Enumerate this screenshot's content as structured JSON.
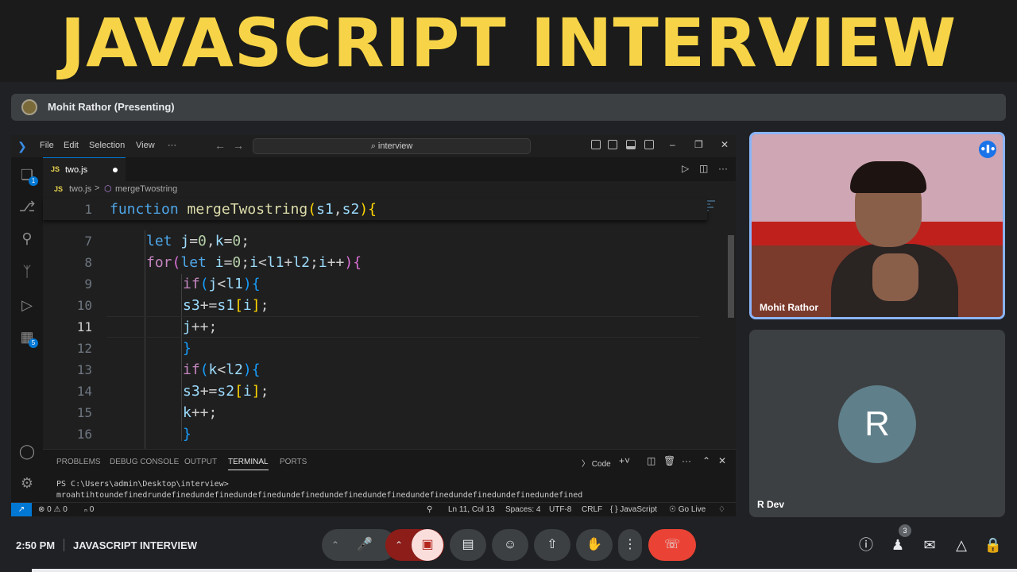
{
  "banner": {
    "title": "JAVASCRIPT INTERVIEW"
  },
  "presenting": {
    "label": "Mohit Rathor (Presenting)"
  },
  "vscode": {
    "menu": [
      "File",
      "Edit",
      "Selection",
      "View",
      "···"
    ],
    "search": "⌕ interview",
    "tab": {
      "lang": "JS",
      "name": "two.js"
    },
    "breadcrumb": {
      "lang": "JS",
      "file": "two.js",
      "separator": ">",
      "symbol_icon": "⬡",
      "symbol": "mergeTwostring"
    },
    "sticky_line": {
      "number": "1",
      "code": "function mergeTwostring(s1,s2){"
    },
    "lines": [
      {
        "number": "7",
        "code": "let j=0,k=0;"
      },
      {
        "number": "8",
        "code": "for(let i=0;i<l1+l2;i++){"
      },
      {
        "number": "9",
        "code": "if(j<l1){"
      },
      {
        "number": "10",
        "code": "s3+=s1[i];"
      },
      {
        "number": "11",
        "code": "j++;"
      },
      {
        "number": "12",
        "code": "}"
      },
      {
        "number": "13",
        "code": "if(k<l2){"
      },
      {
        "number": "14",
        "code": "s3+=s2[i];"
      },
      {
        "number": "15",
        "code": "k++;"
      },
      {
        "number": "16",
        "code": "}"
      }
    ],
    "panel_tabs": [
      "PROBLEMS",
      "DEBUG CONSOLE",
      "OUTPUT",
      "TERMINAL",
      "PORTS"
    ],
    "terminal_shell": "Code",
    "terminal": {
      "prompt": "PS C:\\Users\\admin\\Desktop\\interview>",
      "output": "mroahtihtoundefinedrundefinedundefinedundefinedundefinedundefinedundefinedundefinedundefinedundefinedundefined"
    },
    "status": {
      "errors": "⊗ 0 ⚠ 0",
      "ports": "ₙ 0",
      "position": "Ln 11, Col 13",
      "spaces": "Spaces: 4",
      "encoding": "UTF-8",
      "eol": "CRLF",
      "language": "{ } JavaScript",
      "golive": "Go Live"
    },
    "badges": {
      "explorer": "1",
      "extensions": "5"
    }
  },
  "participants": [
    {
      "name": "Mohit Rathor"
    },
    {
      "name": "R Dev",
      "initial": "R"
    }
  ],
  "bottombar": {
    "time": "2:50 PM",
    "meeting": "JAVASCRIPT INTERVIEW",
    "people_count": "3"
  },
  "colors": {
    "banner_text": "#f7d447",
    "accent_blue": "#0078d4",
    "meet_red": "#ea4335"
  }
}
